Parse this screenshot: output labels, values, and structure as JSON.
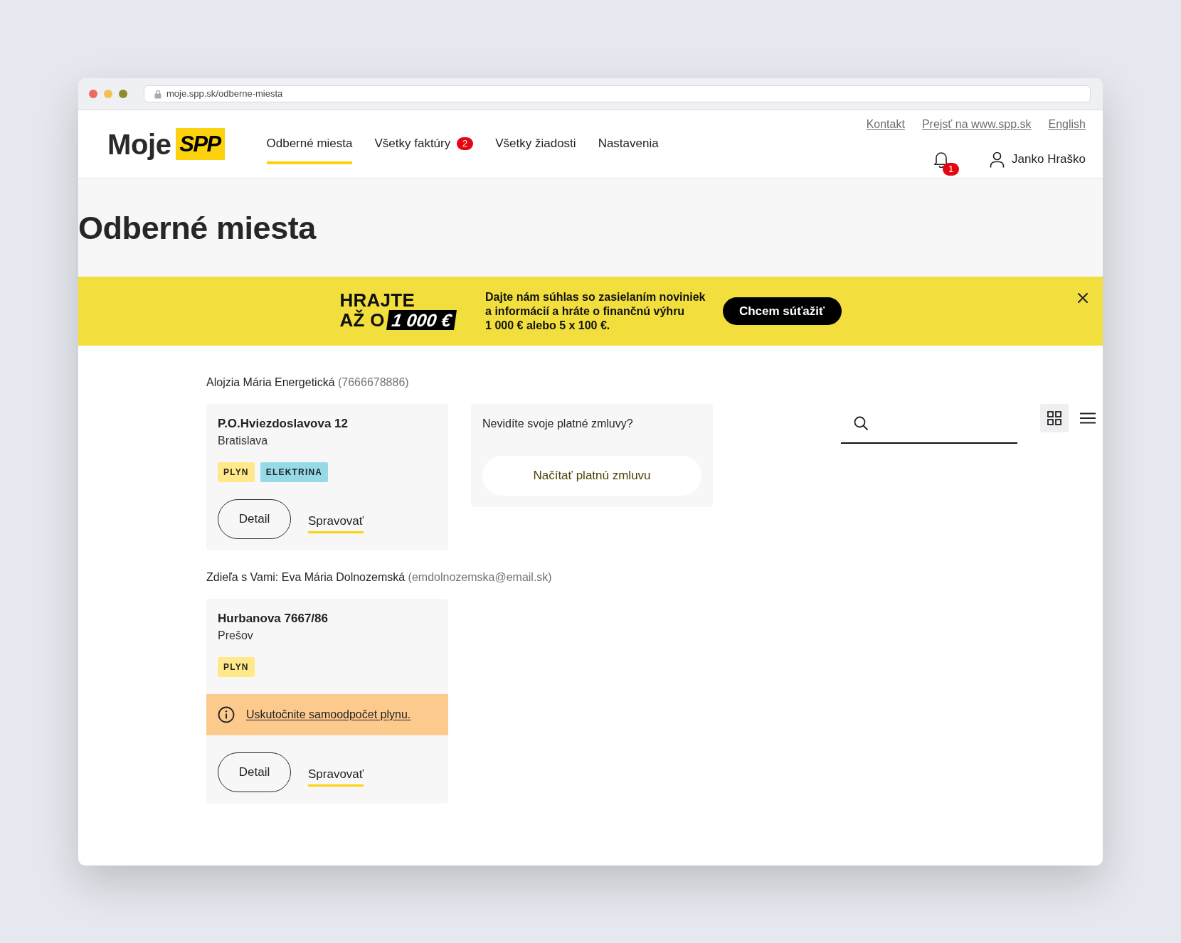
{
  "browser": {
    "url": "moje.spp.sk/odberne-miesta"
  },
  "header": {
    "logo": {
      "wordmark": "Moje",
      "mark": "SPP"
    },
    "nav": [
      {
        "label": "Odberné miesta",
        "selected": true
      },
      {
        "label": "Všetky faktúry",
        "badge": "2",
        "selected": false
      },
      {
        "label": "Všetky žiadosti",
        "selected": false
      },
      {
        "label": "Nastavenia",
        "selected": false
      }
    ],
    "top_links": [
      "Kontakt",
      "Prejsť na www.spp.sk",
      "English"
    ],
    "notifications": {
      "badge": "1"
    },
    "user": {
      "name": "Janko Hraško"
    }
  },
  "page_title": "Odberné miesta",
  "promo_banner": {
    "headline": [
      "HRAJTE",
      "AŽ O"
    ],
    "prize": "1 000 €",
    "lines": [
      "Dajte nám súhlas so zasielaním noviniek",
      "a informácií a hráte o finančnú výhru",
      "1 000 € alebo 5 x 100 €."
    ],
    "button": "Chcem súťažiť"
  },
  "view_options": [
    {
      "kind": "grid",
      "selected": true
    },
    {
      "kind": "list",
      "selected": false
    }
  ],
  "groups": [
    {
      "owner": "Alojzia Mária Energetická",
      "owner_detail": "(7666678886)",
      "places": [
        {
          "street": "P.O.Hviezdoslavova 12",
          "city": "Bratislava",
          "tags": [
            {
              "label": "PLYN",
              "color": "#ffe98a"
            },
            {
              "label": "ELEKTRINA",
              "color": "#96dae8"
            }
          ],
          "detail_button": "Detail",
          "manage_link": "Spravovať"
        }
      ],
      "missing_contracts": {
        "text": "Nevidíte svoje platné zmluvy?",
        "button": "Načítať platnú zmluvu"
      }
    },
    {
      "owner": "Zdieľa s Vami: Eva Mária Dolnozemská",
      "owner_detail": "(emdolnozemska@email.sk)",
      "places": [
        {
          "street": "Hurbanova 7667/86",
          "city": "Prešov",
          "tags": [
            {
              "label": "PLYN",
              "color": "#ffe98a"
            }
          ],
          "notice": {
            "text": "Uskutočnite samoodpočet plynu."
          },
          "detail_button": "Detail",
          "manage_link": "Spravovať"
        }
      ]
    }
  ]
}
